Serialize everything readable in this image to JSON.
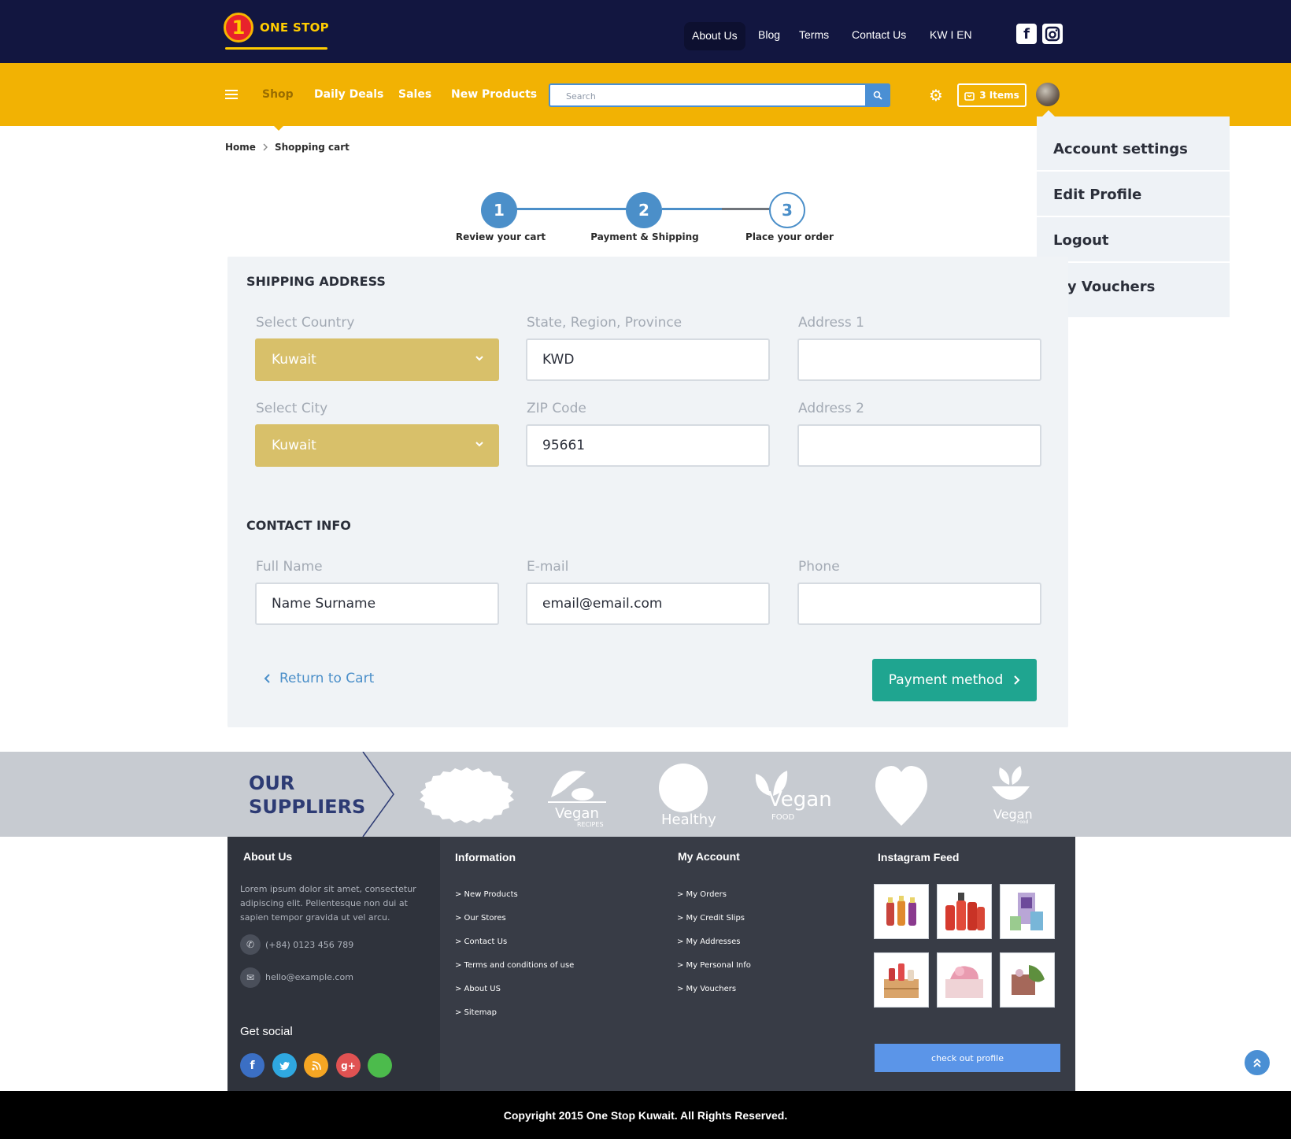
{
  "brand": {
    "logo_number": "1",
    "logo_text": "ONE STOP"
  },
  "topnav": {
    "items": [
      {
        "label": "About Us"
      },
      {
        "label": "Blog"
      },
      {
        "label": "Terms"
      },
      {
        "label": "Contact Us"
      },
      {
        "label": "KW I EN"
      }
    ],
    "social_icons": [
      "facebook-icon",
      "instagram-icon"
    ]
  },
  "mainnav": {
    "items": [
      {
        "label": "Shop"
      },
      {
        "label": "Daily Deals"
      },
      {
        "label": "Sales"
      },
      {
        "label": "New Products"
      }
    ],
    "search_placeholder": "Search",
    "cart_label": "3 Items"
  },
  "account_menu": {
    "items": [
      {
        "label": "Account settings"
      },
      {
        "label": "Edit Profile"
      },
      {
        "label": "Logout"
      },
      {
        "label": "My Vouchers"
      }
    ]
  },
  "breadcrumb": {
    "home": "Home",
    "current": "Shopping cart"
  },
  "steps": [
    {
      "number": "1",
      "label": "Review your cart",
      "state": "done"
    },
    {
      "number": "2",
      "label": "Payment & Shipping",
      "state": "active"
    },
    {
      "number": "3",
      "label": "Place your order",
      "state": "pending"
    }
  ],
  "shipping": {
    "title": "SHIPPING ADDRESS",
    "country_label": "Select Country",
    "country_value": "Kuwait",
    "state_label": "State, Region, Province",
    "state_value": "KWD",
    "address1_label": "Address 1",
    "address1_value": "",
    "city_label": "Select City",
    "city_value": "Kuwait",
    "zip_label": "ZIP Code",
    "zip_value": "95661",
    "address2_label": "Address 2",
    "address2_value": ""
  },
  "contact": {
    "title": "CONTACT INFO",
    "name_label": "Full Name",
    "name_value": "Name Surname",
    "email_label": "E-mail",
    "email_value": "email@email.com",
    "phone_label": "Phone",
    "phone_value": ""
  },
  "actions": {
    "return_label": "Return to Cart",
    "payment_label": "Payment method"
  },
  "suppliers": {
    "title_line1": "OUR",
    "title_line2": "SUPPLIERS",
    "logos": [
      {
        "name": "badge-logo",
        "caption": ""
      },
      {
        "name": "vegan-recipes-logo",
        "caption": "Vegan",
        "sub": "RECIPES"
      },
      {
        "name": "healthy-logo",
        "caption": "Healthy"
      },
      {
        "name": "vegan-food-logo",
        "caption": "Vegan",
        "sub": "FOOD"
      },
      {
        "name": "heart-logo",
        "caption": ""
      },
      {
        "name": "vegan-food-bowl-logo",
        "caption": "Vegan",
        "sub": "Food"
      }
    ]
  },
  "footer": {
    "about": {
      "title": "About Us",
      "text": "Lorem ipsum dolor sit amet, consectetur adipiscing elit. Pellentesque non dui at sapien tempor gravida ut vel arcu.",
      "phone": "(+84) 0123 456 789",
      "email": "hello@example.com",
      "social_title": "Get social"
    },
    "information": {
      "title": "Information",
      "links": [
        "> New Products",
        "> Our Stores",
        "> Contact Us",
        "> Terms and conditions of use",
        "> About US",
        "> Sitemap"
      ]
    },
    "my_account": {
      "title": "My Account",
      "links": [
        "> My Orders",
        "> My Credit Slips",
        "> My Addresses",
        "> My Personal Info",
        "> My Vouchers"
      ]
    },
    "instagram": {
      "title": "Instagram Feed",
      "button": "check out profile"
    },
    "social_colors": {
      "facebook": "#3b6fc4",
      "twitter": "#2fa8e0",
      "rss": "#f5a623",
      "google": "#e05252",
      "other": "#4cbb4c"
    }
  },
  "copyright": "Copyright 2015 One Stop Kuwait. All Rights Reserved.",
  "colors": {
    "topbar": "#121640",
    "navbar": "#f2b203",
    "accent": "#4b8fc9",
    "cta": "#1fa590",
    "select": "#d8c06a"
  }
}
